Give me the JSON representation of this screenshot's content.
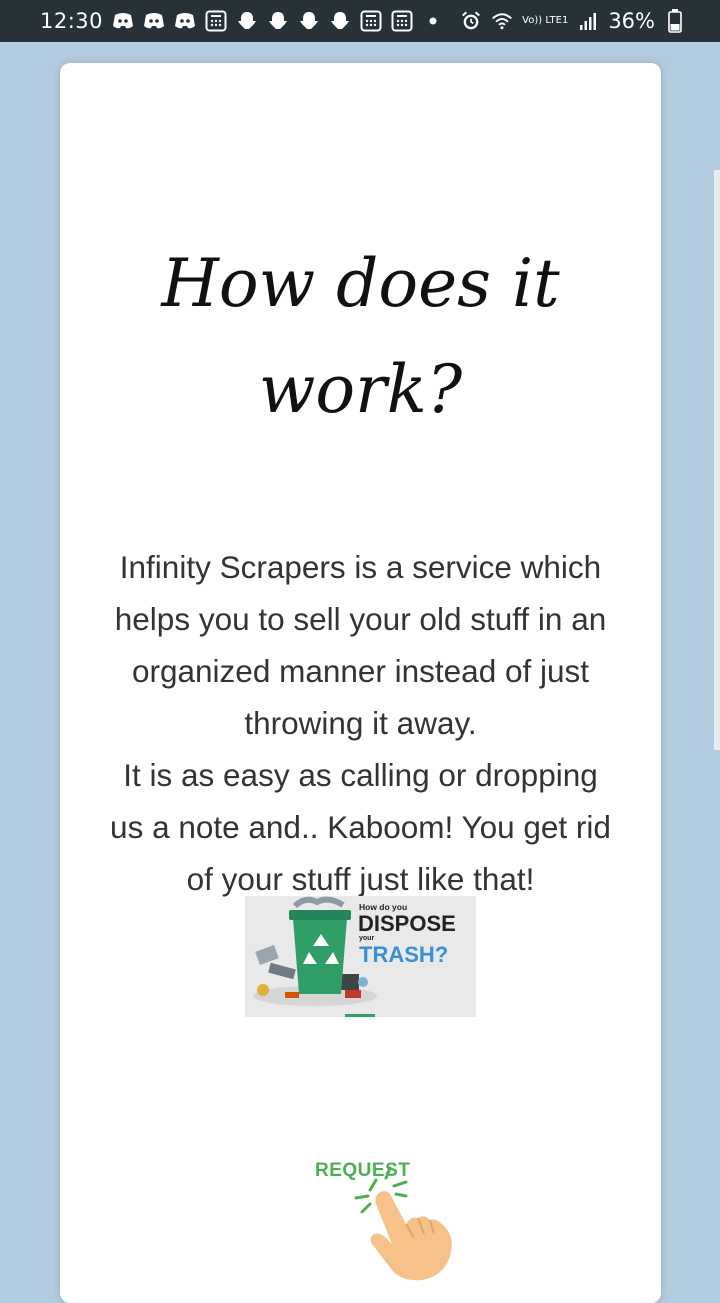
{
  "status_bar": {
    "time": "12:30",
    "notification_icons": [
      "discord-icon",
      "discord-icon",
      "discord-icon",
      "calculator-icon",
      "snapchat-icon",
      "snapchat-icon",
      "snapchat-icon",
      "snapchat-icon",
      "calculator-icon",
      "calculator-icon",
      "dot-icon"
    ],
    "network_label": "Vo)) LTE1",
    "battery_percent": "36%"
  },
  "page": {
    "heading_line1": "How does it",
    "heading_line2": "work?",
    "description_lines": [
      "Infinity Scrapers is a service which",
      "helps you to sell your old stuff in an",
      "organized manner instead of just",
      "throwing it away.",
      "It is as easy as calling or dropping",
      "us a note and.. Kaboom! You get rid",
      "of your stuff just like that!"
    ],
    "image_text": {
      "line1": "How do you",
      "line2": "DISPOSE",
      "line3": "your",
      "line4": "TRASH?"
    },
    "request_label": "REQUEST"
  },
  "colors": {
    "background": "#b3cde0",
    "status_bar": "#263238",
    "request_green": "#4caf50",
    "trash_text_blue": "#3a8fd6",
    "bin_green": "#2e9e66"
  }
}
